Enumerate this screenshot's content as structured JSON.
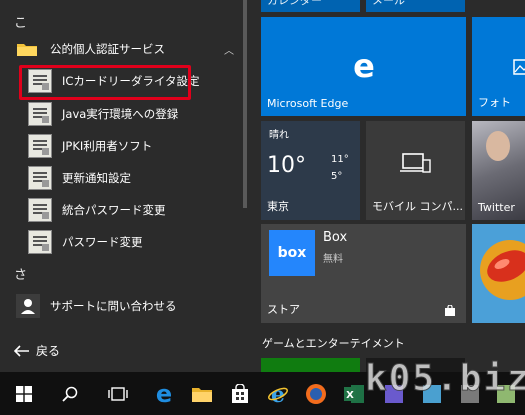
{
  "start_menu": {
    "header_ko": "こ",
    "folder_label": "公的個人認証サービス",
    "items": [
      {
        "label": "ICカードリーダライタ設定"
      },
      {
        "label": "Java実行環境への登録"
      },
      {
        "label": "JPKI利用者ソフト"
      },
      {
        "label": "更新通知設定"
      },
      {
        "label": "統合パスワード変更"
      },
      {
        "label": "パスワード変更"
      }
    ],
    "header_sa": "さ",
    "support_label": "サポートに問い合わせる",
    "back_label": "戻る"
  },
  "tiles": {
    "top_left_partial": "カレンダー",
    "top_right_partial": "メール",
    "edge_label": "Microsoft Edge",
    "photos_label": "フォト",
    "weather": {
      "condition": "晴れ",
      "temp": "10°",
      "high": "11°",
      "low": "5°",
      "city": "東京"
    },
    "mobile_label": "モバイル コンパ...",
    "twitter_label": "Twitter",
    "box_title": "Box",
    "box_sub": "無料",
    "box_logo": "box",
    "store_label": "ストア",
    "group_label": "ゲームとエンターテイメント"
  },
  "colors": {
    "accent": "#0078d7",
    "highlight": "#e0001b"
  },
  "watermark": "k05.biz"
}
